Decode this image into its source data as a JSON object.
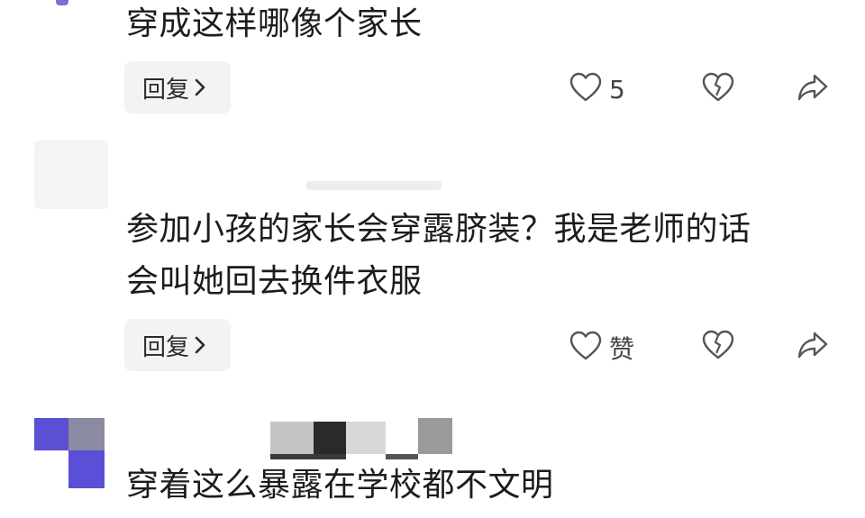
{
  "comments": [
    {
      "text": "穿成这样哪像个家长",
      "reply_label": "回复",
      "like_count": "5"
    },
    {
      "text_line1": "参加小孩的家长会穿露脐装？我是老师的话",
      "text_line2": "会叫她回去换件衣服",
      "reply_label": "回复",
      "like_label": "赞"
    },
    {
      "text": "穿着这么暴露在学校都不文明"
    }
  ],
  "icons": {
    "like": "heart-icon",
    "dislike": "broken-heart-icon",
    "share": "share-icon",
    "chevron": "chevron-right-icon"
  },
  "colors": {
    "background": "#ffffff",
    "reply_bg": "#f3f3f4",
    "icon_stroke": "#555555",
    "mosaic_purple": "#5a4fd6",
    "mosaic_gray": "#8a8a9a"
  }
}
